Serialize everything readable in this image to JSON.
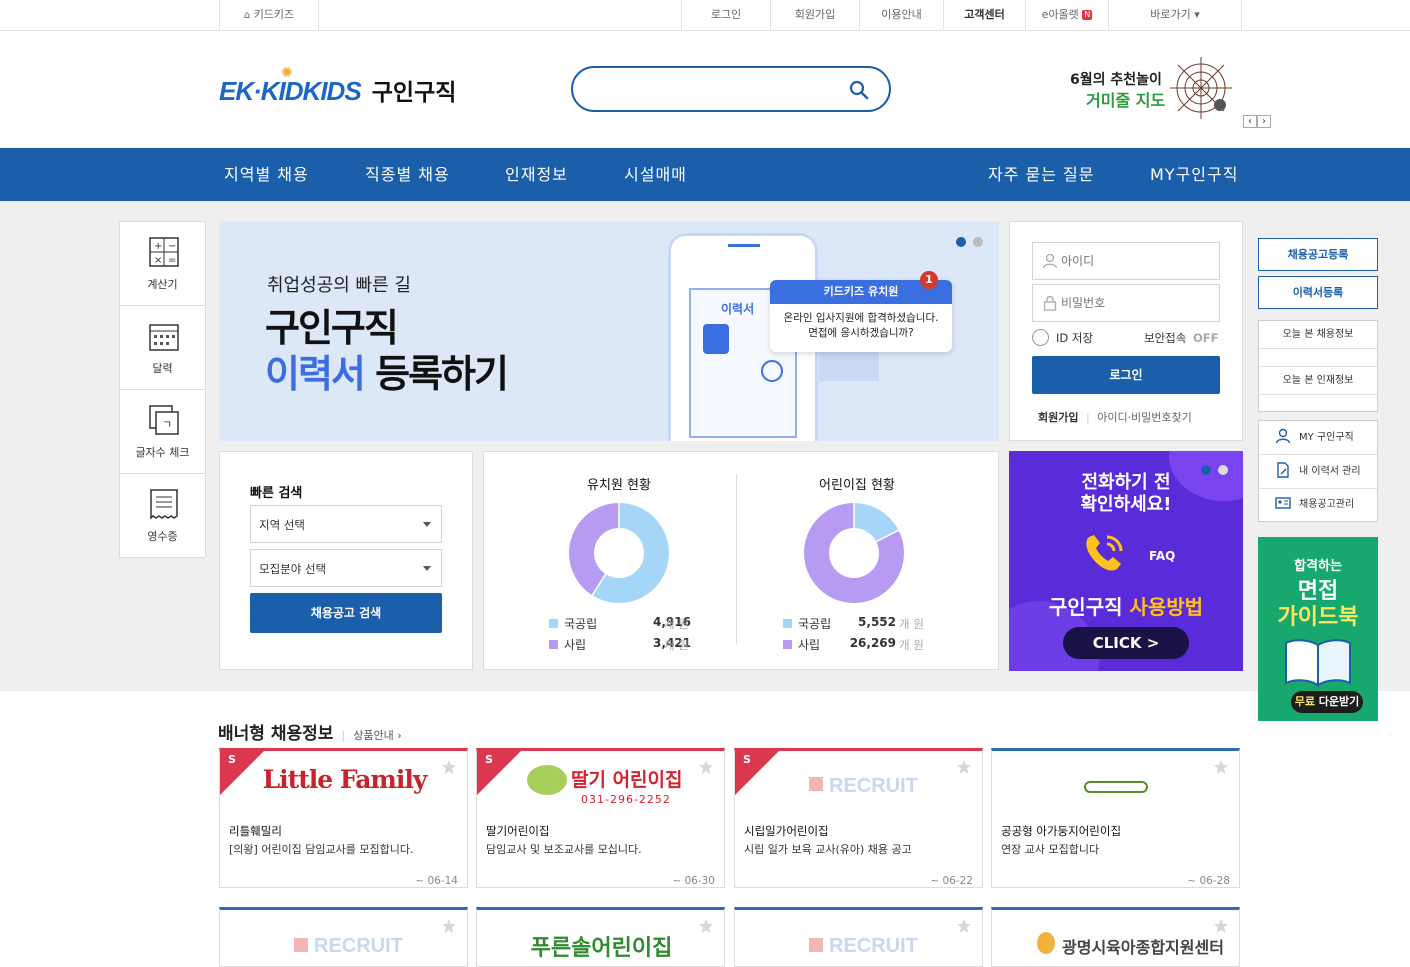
{
  "topbar": {
    "home": "키드키즈",
    "login": "로그인",
    "signup": "회원가입",
    "guide": "이용안내",
    "support": "고객센터",
    "eall": "e아올렛",
    "eall_badge": "N",
    "shortcut": "바로가기 ▾"
  },
  "header": {
    "logo_brand": "EK·KIDKIDS",
    "logo_title": "구인구직",
    "search_placeholder": "",
    "promo_line1": "6월의 추천놀이",
    "promo_line2": "거미줄 지도",
    "prev": "‹",
    "next": "›"
  },
  "nav": {
    "items": [
      "지역별 채용",
      "직종별 채용",
      "인재정보",
      "시설매매",
      "자주 묻는 질문",
      "MY구인구직"
    ]
  },
  "tools": [
    {
      "label": "계산기",
      "icon": "calculator-icon"
    },
    {
      "label": "달력",
      "icon": "calendar-icon"
    },
    {
      "label": "글자수 체크",
      "icon": "char-count-icon"
    },
    {
      "label": "영수증",
      "icon": "receipt-icon"
    }
  ],
  "hero": {
    "sub": "취업성공의 빠른 길",
    "line1": "구인구직",
    "line2a": "이력서",
    "line2b": "등록하기",
    "resume_tag": "이력서",
    "bubble_title": "키드키즈 유치원",
    "bubble_badge": "1",
    "bubble_text1": "온라인 입사지원에 합격하셨습니다.",
    "bubble_text2": "면접에 응시하겠습니까?"
  },
  "login": {
    "id_placeholder": "아이디",
    "pw_placeholder": "비밀번호",
    "save_id": "ID 저장",
    "secure": "보안접속",
    "secure_state": "OFF",
    "submit": "로그인",
    "signup": "회원가입",
    "find": "아이디·비밀번호찾기"
  },
  "quick": {
    "title": "빠른 검색",
    "region": "지역 선택",
    "field": "모집분야 선택",
    "submit": "채용공고 검색"
  },
  "stats": [
    {
      "title": "유치원 현황",
      "public_label": "국공립",
      "public_value": "4,916",
      "private_label": "사립",
      "private_value": "3,421",
      "unit": "개 원",
      "public_frac": 0.59
    },
    {
      "title": "어린이집 현황",
      "public_label": "국공립",
      "public_value": "5,552",
      "private_label": "사립",
      "private_value": "26,269",
      "unit": "개 원",
      "public_frac": 0.175
    }
  ],
  "colors": {
    "public": "#a5d6f7",
    "private": "#b79bf2",
    "brand": "#1b5eaa"
  },
  "faq": {
    "line1": "전화하기 전",
    "line2": "확인하세요!",
    "faq": "FAQ",
    "title_a": "구인구직",
    "title_b": "사용방법",
    "click": "CLICK >"
  },
  "side": {
    "post_job": "채용공고등록",
    "post_resume": "이력서등록",
    "recent_jobs": "오늘 본 채용정보",
    "recent_talent": "오늘 본 인재정보",
    "my": "MY 구인구직",
    "my_resume": "내 이력서 관리",
    "my_jobs": "채용공고관리",
    "guide_line1": "합격하는",
    "guide_line2": "면접",
    "guide_line3": "가이드북",
    "guide_dl_a": "무료",
    "guide_dl_b": "다운받기"
  },
  "banner_section": {
    "title": "배너형 채용정보",
    "link": "상품안내 ›"
  },
  "cards": [
    {
      "logo": "Little Family",
      "name": "리틀훼밀리",
      "desc": "[의왕] 어린이집 담임교사를 모집합니다.",
      "date": "~ 06-14",
      "badge": "S"
    },
    {
      "logo": "딸기 어린이집",
      "phone": "031-296-2252",
      "name": "딸기어린이집",
      "desc": "담임교사 및 보조교사를 모십니다.",
      "date": "~ 06-30",
      "badge": "S"
    },
    {
      "logo": "RECRUIT",
      "name": "시립일가어린이집",
      "desc": "시립 일가 보육 교사(유아) 채용 공고",
      "date": "~ 06-22",
      "badge": "S"
    },
    {
      "logo": "",
      "name": "공공형 아가둥지어린이집",
      "desc": "연장 교사 모집합니다",
      "date": "~ 06-28",
      "badge": ""
    },
    {
      "logo": "RECRUIT"
    },
    {
      "logo": "푸른솔어린이집"
    },
    {
      "logo": "RECRUIT"
    },
    {
      "logo": "광명시육아종합지원센터"
    }
  ]
}
